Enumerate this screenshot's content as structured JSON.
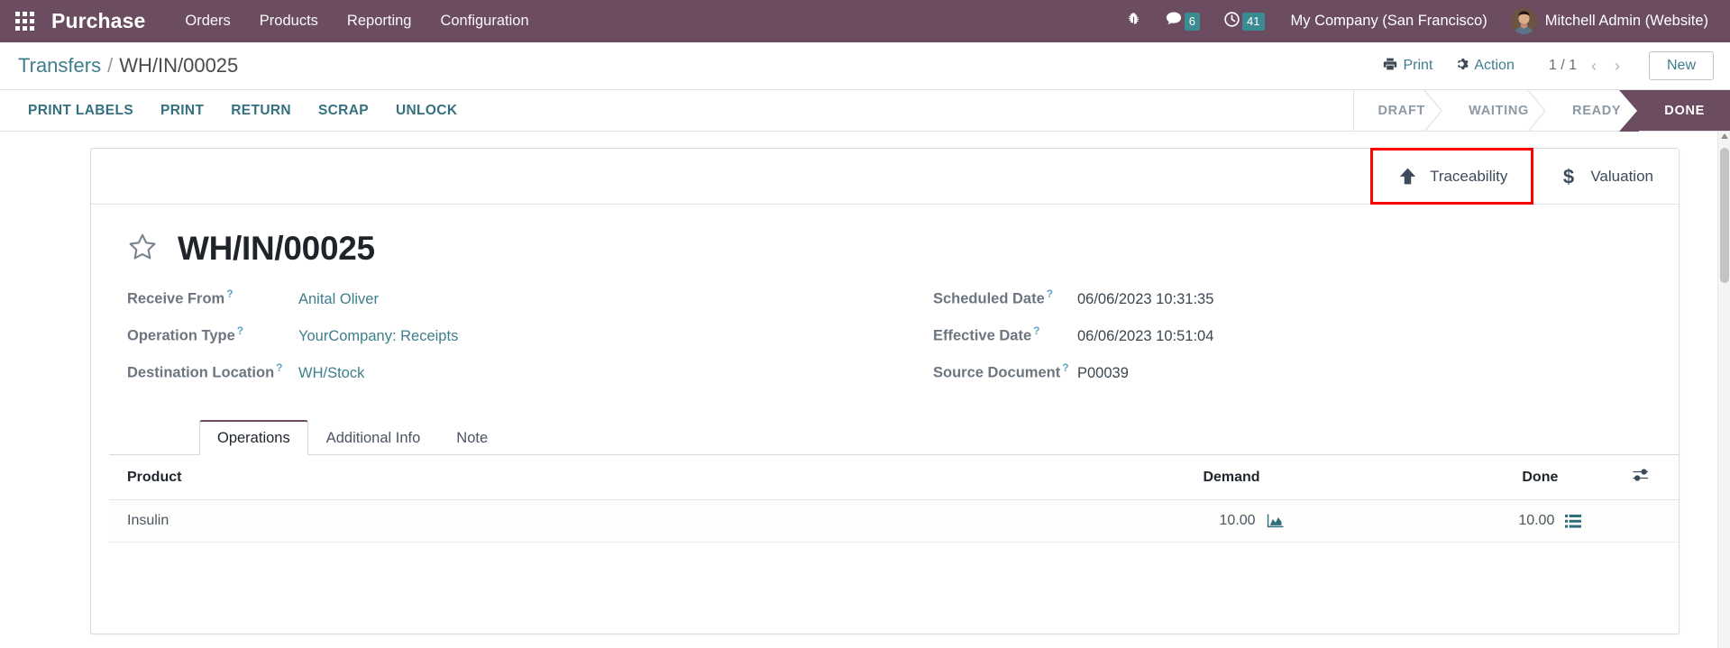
{
  "navbar": {
    "apps_icon": "grid-apps-icon",
    "brand": "Purchase",
    "menu_items": [
      {
        "label": "Orders"
      },
      {
        "label": "Products"
      },
      {
        "label": "Reporting"
      },
      {
        "label": "Configuration"
      }
    ],
    "debug_icon": "bug-icon",
    "messages": {
      "icon": "chat-bubble-icon",
      "count": "6"
    },
    "activities": {
      "icon": "clock-icon",
      "count": "41"
    },
    "company": "My Company (San Francisco)",
    "user": "Mitchell Admin (Website)",
    "avatar_icon": "user-avatar",
    "bg_color": "#6b4c60",
    "badge_color": "#3c8b92"
  },
  "breadcrumb": {
    "root": "Transfers",
    "separator": "/",
    "current": "WH/IN/00025",
    "print_label": "Print",
    "print_icon": "printer-icon",
    "action_label": "Action",
    "action_icon": "gear-icon",
    "pager": "1 / 1",
    "prev_icon": "chevron-left-icon",
    "next_icon": "chevron-right-icon",
    "new_label": "New"
  },
  "control_panel": {
    "buttons": [
      {
        "label": "PRINT LABELS"
      },
      {
        "label": "PRINT"
      },
      {
        "label": "RETURN"
      },
      {
        "label": "SCRAP"
      },
      {
        "label": "UNLOCK"
      }
    ],
    "statusbar": [
      {
        "label": "DRAFT",
        "active": false
      },
      {
        "label": "WAITING",
        "active": false
      },
      {
        "label": "READY",
        "active": false
      },
      {
        "label": "DONE",
        "active": true
      }
    ],
    "active_status_color": "#6b4c60"
  },
  "smart_buttons": [
    {
      "label": "Traceability",
      "icon": "arrow-up-icon",
      "highlighted": true,
      "highlight_color": "#fe0000"
    },
    {
      "label": "Valuation",
      "icon": "dollar-sign-icon",
      "highlighted": false
    }
  ],
  "record": {
    "favorite_icon": "star-outline-icon",
    "name": "WH/IN/00025",
    "fields_left": [
      {
        "label": "Receive From",
        "value": "Anital Oliver",
        "is_link": true,
        "tooltip": "?"
      },
      {
        "label": "Operation Type",
        "value": "YourCompany: Receipts",
        "is_link": true,
        "tooltip": "?"
      },
      {
        "label": "Destination Location",
        "value": "WH/Stock",
        "is_link": true,
        "tooltip": "?"
      }
    ],
    "fields_right": [
      {
        "label": "Scheduled Date",
        "value": "06/06/2023 10:31:35",
        "is_link": false,
        "tooltip": "?"
      },
      {
        "label": "Effective Date",
        "value": "06/06/2023 10:51:04",
        "is_link": false,
        "tooltip": "?"
      },
      {
        "label": "Source Document",
        "value": "P00039",
        "is_link": false,
        "tooltip": "?"
      }
    ]
  },
  "notebook": {
    "tabs": [
      {
        "label": "Operations",
        "active": true
      },
      {
        "label": "Additional Info",
        "active": false
      },
      {
        "label": "Note",
        "active": false
      }
    ]
  },
  "lines_table": {
    "columns": [
      {
        "label": "Product"
      },
      {
        "label": "Demand"
      },
      {
        "label": "Done"
      }
    ],
    "optional_columns_icon": "sliders-icon",
    "rows": [
      {
        "product": "Insulin",
        "demand": "10.00",
        "demand_icon": "forecast-chart-icon",
        "done": "10.00",
        "done_icon": "detailed-operations-icon"
      }
    ]
  }
}
